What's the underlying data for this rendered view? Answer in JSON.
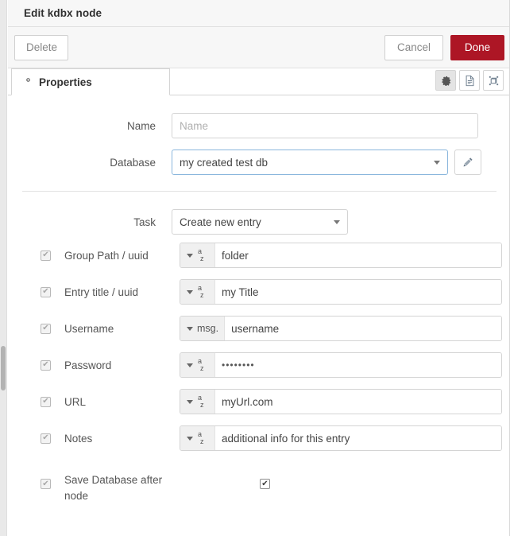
{
  "window": {
    "title": "Edit kdbx node"
  },
  "toolbar": {
    "delete_label": "Delete",
    "cancel_label": "Cancel",
    "done_label": "Done",
    "done_color": "#ad1625"
  },
  "tabs": {
    "properties_label": "Properties",
    "icons": [
      "gear-icon",
      "description-icon",
      "appearance-icon"
    ]
  },
  "form": {
    "name": {
      "label": "Name",
      "value": "",
      "placeholder": "Name"
    },
    "database": {
      "label": "Database",
      "value": "my created test db",
      "edit_icon": "pencil-icon"
    },
    "task": {
      "label": "Task",
      "value": "Create new entry"
    },
    "typed_rows": [
      {
        "label": "Group Path / uuid",
        "type": "str",
        "type_label": "",
        "value": "folder",
        "enabled": true,
        "masked": false
      },
      {
        "label": "Entry title / uuid",
        "type": "str",
        "type_label": "",
        "value": "my Title",
        "enabled": true,
        "masked": false
      },
      {
        "label": "Username",
        "type": "msg",
        "type_label": "msg.",
        "value": "username",
        "enabled": true,
        "masked": false
      },
      {
        "label": "Password",
        "type": "str",
        "type_label": "",
        "value": "••••••••",
        "enabled": true,
        "masked": true
      },
      {
        "label": "URL",
        "type": "str",
        "type_label": "",
        "value": "myUrl.com",
        "enabled": true,
        "masked": false
      },
      {
        "label": "Notes",
        "type": "str",
        "type_label": "",
        "value": "additional info for this entry",
        "enabled": true,
        "masked": false
      }
    ],
    "save_after_node": {
      "label": "Save Database after node",
      "checked": true
    }
  },
  "checkmark": "✔"
}
